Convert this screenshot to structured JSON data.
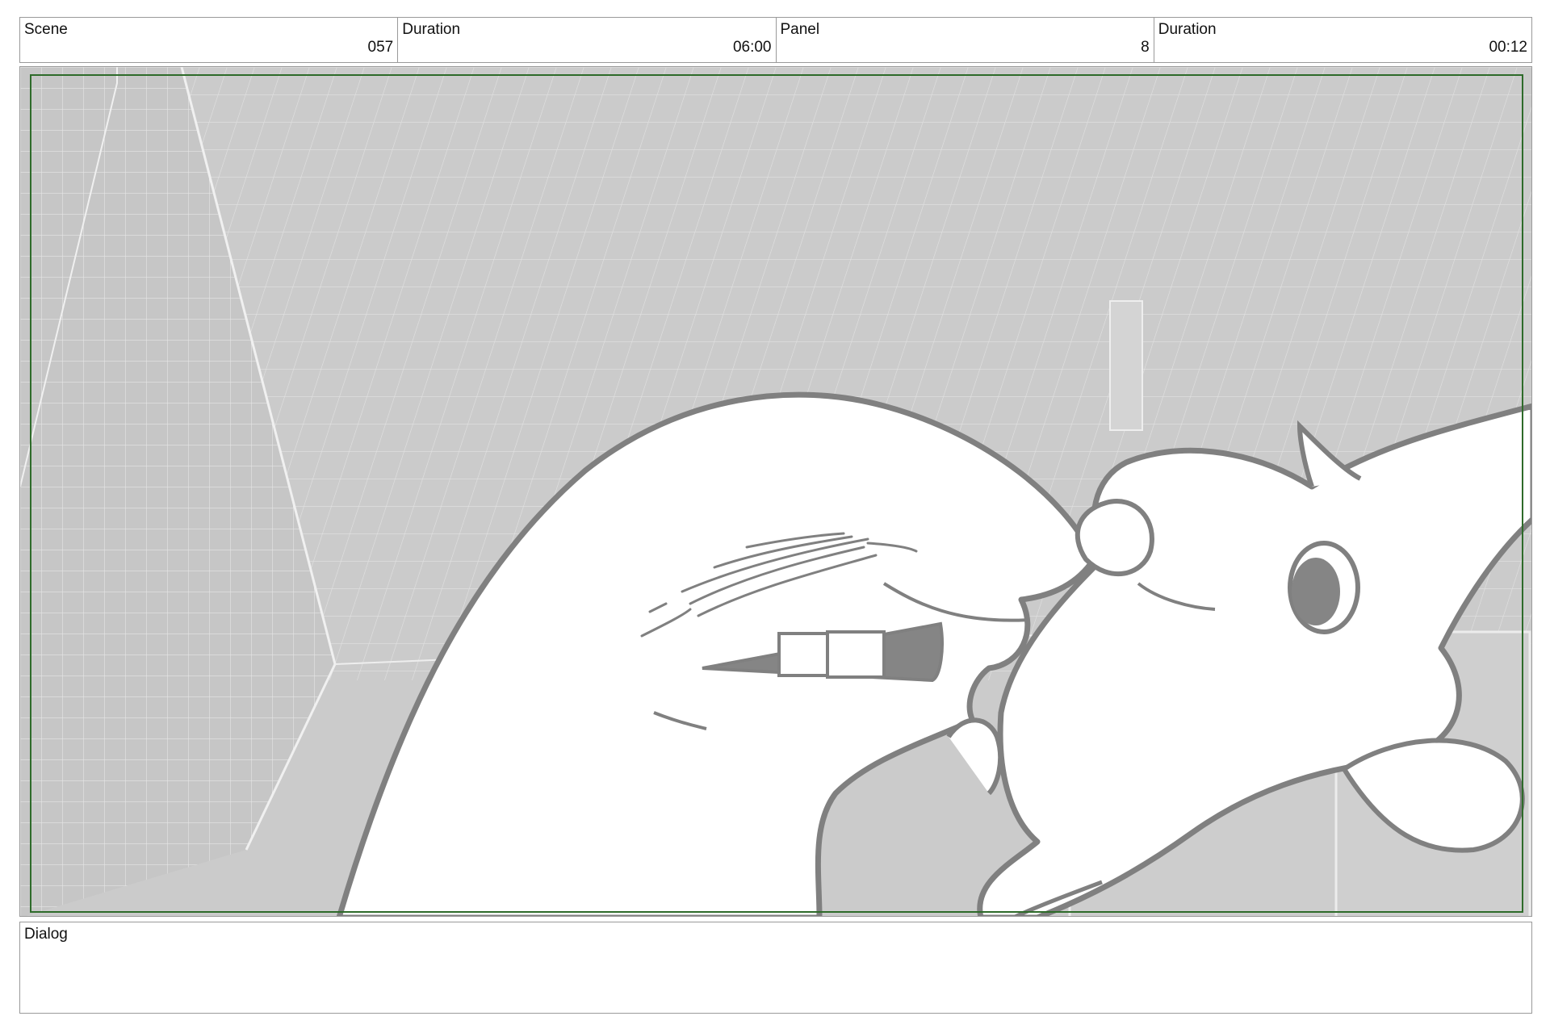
{
  "header": {
    "scene_label": "Scene",
    "scene_value": "057",
    "scene_duration_label": "Duration",
    "scene_duration_value": "06:00",
    "panel_label": "Panel",
    "panel_value": "8",
    "panel_duration_label": "Duration",
    "panel_duration_value": "00:12"
  },
  "dialog": {
    "label": "Dialog",
    "text": ""
  },
  "colors": {
    "safe_frame": "#2e6b2a",
    "line_art": "#808080",
    "background_grid": "#cfcfcf"
  }
}
